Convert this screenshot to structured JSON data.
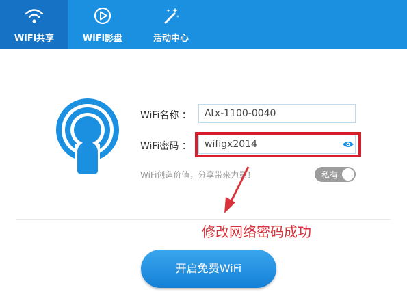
{
  "nav": {
    "tabs": [
      {
        "label": "WiFi共享",
        "icon": "wifi-icon",
        "active": true
      },
      {
        "label": "WiFi影盘",
        "icon": "play-circle-icon",
        "active": false
      },
      {
        "label": "活动中心",
        "icon": "magic-wand-icon",
        "active": false
      }
    ]
  },
  "form": {
    "name_label": "WiFi名称 ：",
    "name_value": "Atx-1100-0040",
    "password_label": "WiFi密码 ：",
    "password_value": "wifigx2014",
    "hint": "WiFi创造价值，分享带来力量！",
    "private_toggle": {
      "label": "私有",
      "on": false
    }
  },
  "annotation": {
    "text": "修改网络密码成功"
  },
  "start_button": {
    "label": "开启免费WiFi"
  },
  "colors": {
    "accent": "#1b8fe0",
    "active_tab": "#1572c4",
    "highlight": "#d81e2c"
  }
}
